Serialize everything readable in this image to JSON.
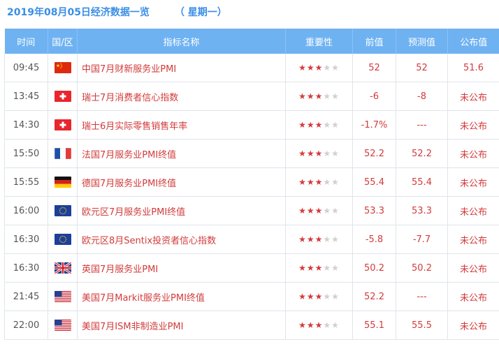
{
  "header": {
    "title": "2019年08月05日经济数据一览",
    "weekday": "（ 星期一）"
  },
  "columns": [
    "时间",
    "国/区",
    "指标名称",
    "重要性",
    "前值",
    "预测值",
    "公布值"
  ],
  "rows": [
    {
      "time": "09:45",
      "flag": "china-flag-icon",
      "indicator": "中国7月财新服务业PMI",
      "stars": 3,
      "prev": "52",
      "forecast": "52",
      "actual": "51.6"
    },
    {
      "time": "13:45",
      "flag": "switzerland-flag-icon",
      "indicator": "瑞士7月消费者信心指数",
      "stars": 3,
      "prev": "-6",
      "forecast": "-8",
      "actual": "未公布"
    },
    {
      "time": "14:30",
      "flag": "switzerland-flag-icon",
      "indicator": "瑞士6月实际零售销售年率",
      "stars": 3,
      "prev": "-1.7%",
      "forecast": "---",
      "actual": "未公布"
    },
    {
      "time": "15:50",
      "flag": "france-flag-icon",
      "indicator": "法国7月服务业PMI终值",
      "stars": 3,
      "prev": "52.2",
      "forecast": "52.2",
      "actual": "未公布"
    },
    {
      "time": "15:55",
      "flag": "germany-flag-icon",
      "indicator": "德国7月服务业PMI终值",
      "stars": 3,
      "prev": "55.4",
      "forecast": "55.4",
      "actual": "未公布"
    },
    {
      "time": "16:00",
      "flag": "eu-flag-icon",
      "indicator": "欧元区7月服务业PMI终值",
      "stars": 3,
      "prev": "53.3",
      "forecast": "53.3",
      "actual": "未公布"
    },
    {
      "time": "16:30",
      "flag": "eu-flag-icon",
      "indicator": "欧元区8月Sentix投资者信心指数",
      "stars": 3,
      "prev": "-5.8",
      "forecast": "-7.7",
      "actual": "未公布"
    },
    {
      "time": "16:30",
      "flag": "uk-flag-icon",
      "indicator": "英国7月服务业PMI",
      "stars": 3,
      "prev": "50.2",
      "forecast": "50.2",
      "actual": "未公布"
    },
    {
      "time": "21:45",
      "flag": "usa-flag-icon",
      "indicator": "美国7月Markit服务业PMI终值",
      "stars": 3,
      "prev": "52.2",
      "forecast": "---",
      "actual": "未公布"
    },
    {
      "time": "22:00",
      "flag": "usa-flag-icon",
      "indicator": "美国7月ISM非制造业PMI",
      "stars": 3,
      "prev": "55.1",
      "forecast": "55.5",
      "actual": "未公布"
    }
  ],
  "max_stars": 5,
  "colors": {
    "accent": "#3a8ee6",
    "header_bg": "#6fb2f2",
    "value_red": "#d23b3b",
    "star_off": "#d0d0d0"
  }
}
